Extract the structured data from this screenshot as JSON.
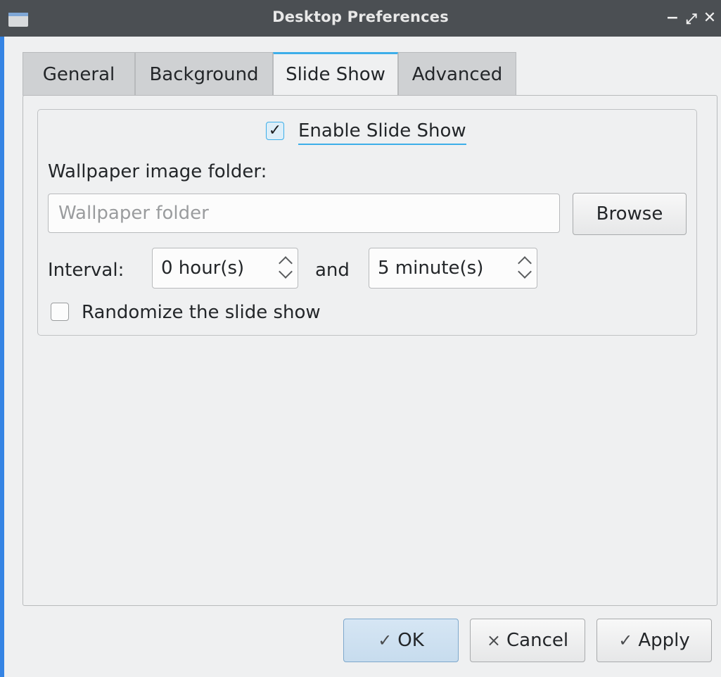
{
  "window": {
    "title": "Desktop Preferences",
    "controls": {
      "minimize": "−",
      "maximize": "⤢",
      "close": "✕"
    }
  },
  "tabs": [
    {
      "label": "General",
      "active": false
    },
    {
      "label": "Background",
      "active": false
    },
    {
      "label": "Slide Show",
      "active": true
    },
    {
      "label": "Advanced",
      "active": false
    }
  ],
  "slideshow": {
    "enable_label": "Enable Slide Show",
    "enable_checked": true,
    "folder_label": "Wallpaper image folder:",
    "folder_value": "",
    "folder_placeholder": "Wallpaper folder",
    "browse_label": "Browse",
    "interval_label": "Interval:",
    "hours_value": "0 hour(s)",
    "and_label": "and",
    "minutes_value": "5 minute(s)",
    "randomize_label": "Randomize the slide show",
    "randomize_checked": false
  },
  "buttons": {
    "ok": {
      "glyph": "✓",
      "label": "OK"
    },
    "cancel": {
      "glyph": "×",
      "label": "Cancel"
    },
    "apply": {
      "glyph": "✓",
      "label": "Apply"
    }
  },
  "colors": {
    "accent": "#3daee9",
    "titlebar": "#4b4f53",
    "window_bg": "#eff0f1"
  }
}
